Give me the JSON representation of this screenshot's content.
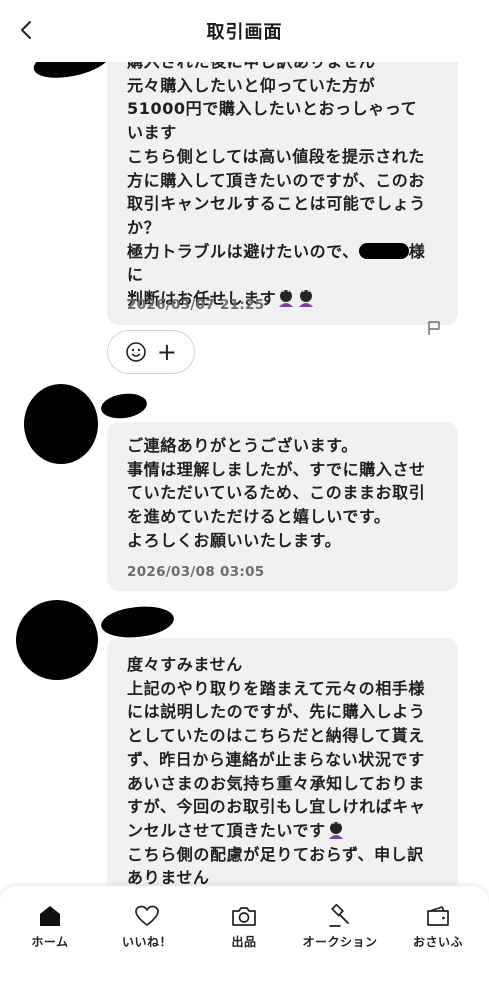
{
  "header": {
    "title": "取引画面"
  },
  "messages": [
    {
      "lines": [
        "購入された後に申し訳ありません",
        "元々購入したいと仰っていた方が",
        "51000円で購入したいとおっしゃって",
        "います",
        "こちら側としては高い値段を提示された",
        "方に購入して頂きたいのですが、このお",
        "取引キャンセルすることは可能でしょう",
        "か？"
      ],
      "line_before_redaction": "極力トラブルは避けたいので、",
      "line_after_redaction": "様に",
      "last_line": "判断はお任せします",
      "timestamp": "2026/03/07 21:25"
    },
    {
      "text": "ご連絡ありがとうございます。\n事情は理解しましたが、すでに購入させ\nていただいているため、このままお取引\nを進めていただけると嬉しいです。\nよろしくお願いいたします。",
      "timestamp": "2026/03/08 03:05"
    },
    {
      "text_a": "度々すみません\n上記のやり取りを踏まえて元々の相手様\nには説明したのですが、先に購入しよう\nとしていたのはこちらだと納得して貰え\nず、昨日から連絡が止まらない状況です\nあいさまのお気持ち重々承知しておりま\nすが、今回のお取引もし宜しければキャ\nンセルさせて頂きたいです",
      "text_b": "こちら側の配慮が足りておらず、申し訳\nありません"
    }
  ],
  "reaction": {
    "add_symbol": "+"
  },
  "tabs": [
    {
      "label": "ホーム"
    },
    {
      "label": "いいね！"
    },
    {
      "label": "出品"
    },
    {
      "label": "オークション"
    },
    {
      "label": "おさいふ"
    }
  ]
}
